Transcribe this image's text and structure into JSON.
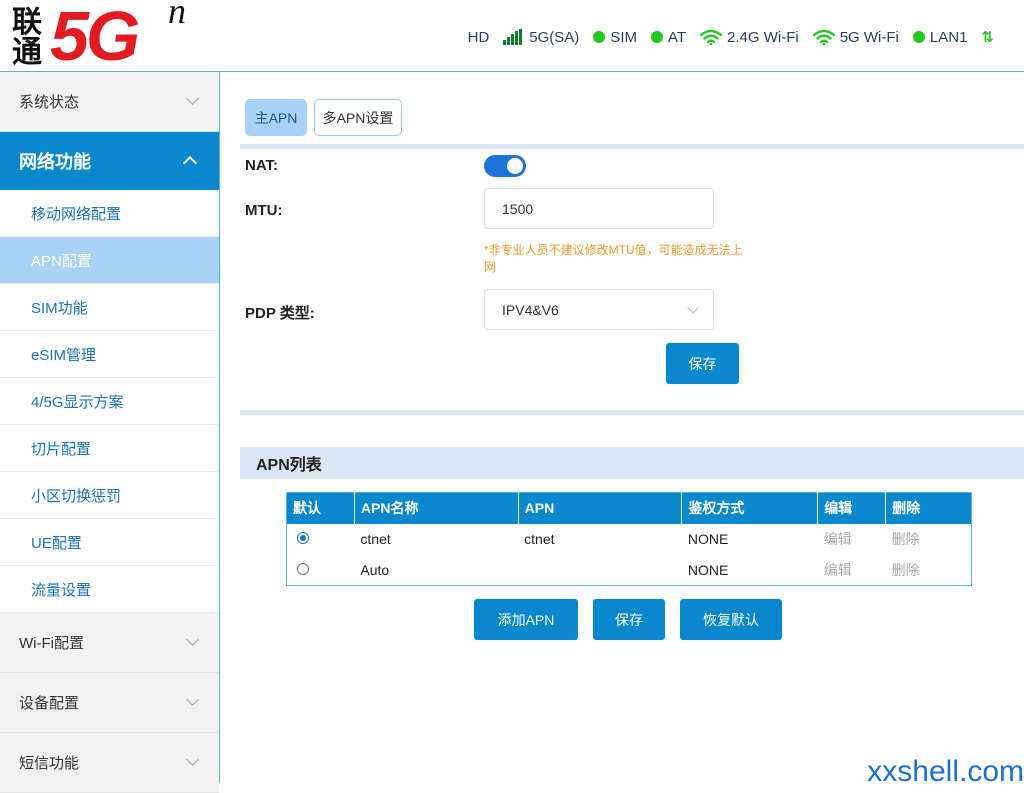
{
  "brand": {
    "cn_text": "联通",
    "main_text": "5G",
    "superscript": "n"
  },
  "status_bar": {
    "hd": "HD",
    "network": "5G(SA)",
    "sim": "SIM",
    "at": "AT",
    "wifi24": "2.4G Wi-Fi",
    "wifi5": "5G Wi-Fi",
    "lan1": "LAN1",
    "dot_color": "#22c81e"
  },
  "sidebar": {
    "system_status": "系统状态",
    "network_function": "网络功能",
    "sub_items": [
      "移动网络配置",
      "APN配置",
      "SIM功能",
      "eSIM管理",
      "4/5G显示方案",
      "切片配置",
      "小区切换惩罚",
      "UE配置",
      "流量设置"
    ],
    "wifi_config": "Wi-Fi配置",
    "device_config": "设备配置",
    "sms_function": "短信功能"
  },
  "tabs": {
    "main_apn": "主APN",
    "multi_apn": "多APN设置"
  },
  "form": {
    "nat_label": "NAT:",
    "nat_enabled": true,
    "mtu_label": "MTU:",
    "mtu_value": "1500",
    "mtu_warning": "*非专业人员不建议修改MTU值，可能造成无法上网",
    "pdp_label": "PDP 类型:",
    "pdp_value": "IPV4&V6",
    "save": "保存"
  },
  "apn_list": {
    "title": "APN列表",
    "headers": [
      "默认",
      "APN名称",
      "APN",
      "鉴权方式",
      "编辑",
      "删除"
    ],
    "rows": [
      {
        "default": true,
        "name": "ctnet",
        "apn": "ctnet",
        "auth": "NONE",
        "edit": "编辑",
        "delete": "删除"
      },
      {
        "default": false,
        "name": "Auto",
        "apn": "",
        "auth": "NONE",
        "edit": "编辑",
        "delete": "删除"
      }
    ],
    "add_btn": "添加APN",
    "save_btn": "保存",
    "restore_btn": "恢复默认"
  },
  "watermark": "xxshell.com",
  "colors": {
    "primary": "#0a88cd",
    "selected": "#a9d3f6",
    "warning": "#f09a2c",
    "brand_red": "#e21b23"
  }
}
